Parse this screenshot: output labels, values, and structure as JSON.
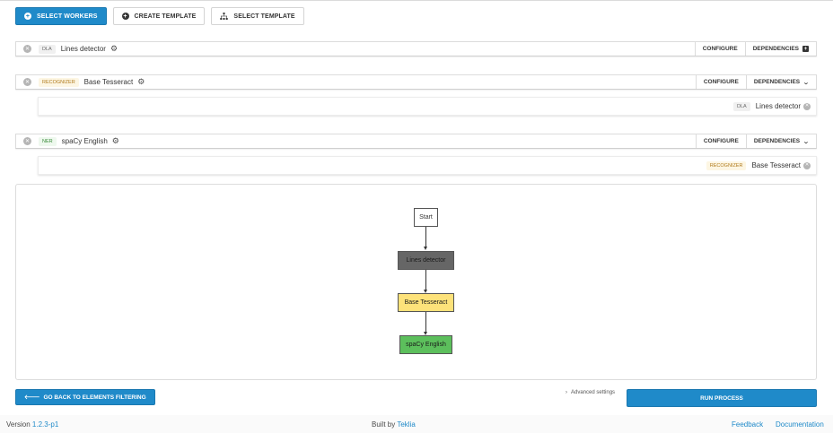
{
  "toolbar": {
    "select_workers": "SELECT WORKERS",
    "create_template": "CREATE TEMPLATE",
    "select_template": "SELECT TEMPLATE"
  },
  "workers": [
    {
      "tag": "DLA",
      "name": "Lines detector",
      "configure": "CONFIGURE",
      "dependencies": "DEPENDENCIES",
      "expanded": false
    },
    {
      "tag": "RECOGNIZER",
      "name": "Base Tesseract",
      "configure": "CONFIGURE",
      "dependencies": "DEPENDENCIES",
      "expanded": true,
      "dependency": {
        "tag": "DLA",
        "name": "Lines detector"
      }
    },
    {
      "tag": "NER",
      "name": "spaCy English",
      "configure": "CONFIGURE",
      "dependencies": "DEPENDENCIES",
      "expanded": true,
      "dependency": {
        "tag": "RECOGNIZER",
        "name": "Base Tesseract"
      }
    }
  ],
  "graph": {
    "nodes": [
      {
        "label": "Start",
        "color": "#ffffff"
      },
      {
        "label": "Lines detector",
        "color": "#666666"
      },
      {
        "label": "Base Tesseract",
        "color": "#fde27a"
      },
      {
        "label": "spaCy English",
        "color": "#5cbf5c"
      }
    ]
  },
  "actions": {
    "back": "GO BACK TO ELEMENTS FILTERING",
    "advanced": "Advanced settings",
    "run": "RUN PROCESS"
  },
  "footer": {
    "version_label": "Version",
    "version": "1.2.3-p1",
    "built_by_label": "Built by",
    "built_by": "Teklia",
    "feedback": "Feedback",
    "documentation": "Documentation"
  },
  "colors": {
    "primary": "#1f8ac9"
  }
}
